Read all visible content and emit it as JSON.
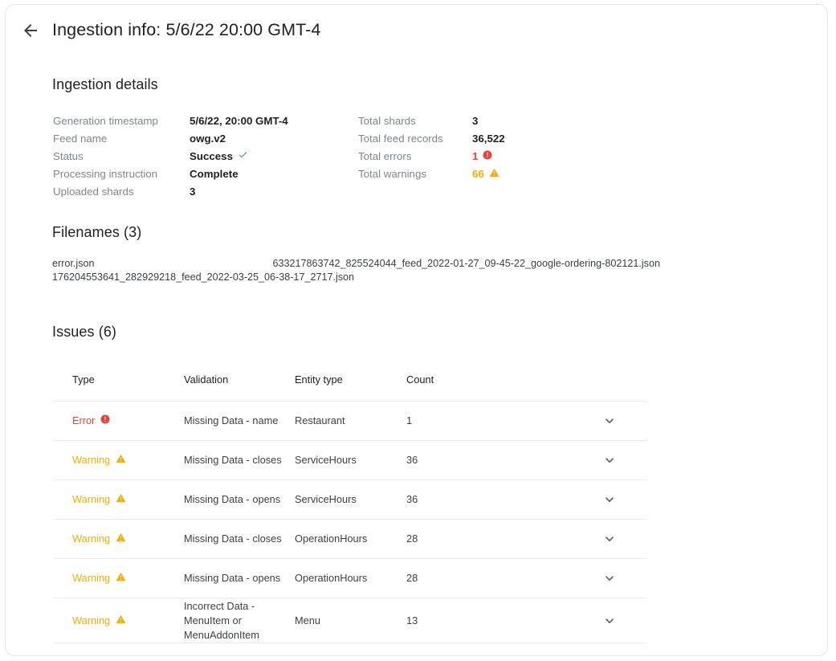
{
  "header": {
    "back_icon": "arrow-left-icon",
    "title": "Ingestion info: 5/6/22 20:00 GMT-4"
  },
  "colors": {
    "error": "#EA4335",
    "warning": "#F9AB00",
    "success": "#34A853",
    "text_primary": "#202124",
    "text_secondary": "#80868B",
    "divider": "#EBEBEB"
  },
  "details": {
    "title": "Ingestion details",
    "left": [
      {
        "label": "Generation timestamp",
        "value": "5/6/22, 20:00 GMT-4"
      },
      {
        "label": "Feed name",
        "value": "owg.v2"
      },
      {
        "label": "Status",
        "value": "Success",
        "icon": "check-icon",
        "icon_color": "#34A853"
      },
      {
        "label": "Processing instruction",
        "value": "Complete"
      },
      {
        "label": "Uploaded shards",
        "value": "3"
      }
    ],
    "right": [
      {
        "label": "Total shards",
        "value": "3"
      },
      {
        "label": "Total feed records",
        "value": "36,522"
      },
      {
        "label": "Total errors",
        "value": "1",
        "icon": "error-icon",
        "state": "error"
      },
      {
        "label": "Total warnings",
        "value": "66",
        "icon": "warning-icon",
        "state": "warning"
      }
    ]
  },
  "filenames": {
    "title": "Filenames (3)",
    "count": 3,
    "items": [
      "error.json",
      "633217863742_825524044_feed_2022-01-27_09-45-22_google-ordering-802121.json",
      "176204553641_282929218_feed_2022-03-25_06-38-17_2717.json"
    ]
  },
  "issues": {
    "title": "Issues (6)",
    "count": 6,
    "columns": [
      "Type",
      "Validation",
      "Entity type",
      "Count"
    ],
    "expand_icon": "chevron-down-icon",
    "rows": [
      {
        "type": "Error",
        "state": "error",
        "icon": "error-icon",
        "validation": "Missing Data - name",
        "entity_type": "Restaurant",
        "count": "1"
      },
      {
        "type": "Warning",
        "state": "warning",
        "icon": "warning-icon",
        "validation": "Missing Data - closes",
        "entity_type": "ServiceHours",
        "count": "36"
      },
      {
        "type": "Warning",
        "state": "warning",
        "icon": "warning-icon",
        "validation": "Missing Data - opens",
        "entity_type": "ServiceHours",
        "count": "36"
      },
      {
        "type": "Warning",
        "state": "warning",
        "icon": "warning-icon",
        "validation": "Missing Data - closes",
        "entity_type": "OperationHours",
        "count": "28"
      },
      {
        "type": "Warning",
        "state": "warning",
        "icon": "warning-icon",
        "validation": "Missing Data - opens",
        "entity_type": "OperationHours",
        "count": "28"
      },
      {
        "type": "Warning",
        "state": "warning",
        "icon": "warning-icon",
        "validation": "Incorrect Data -\nMenuItem or\nMenuAddonItem",
        "entity_type": "Menu",
        "count": "13"
      }
    ]
  }
}
